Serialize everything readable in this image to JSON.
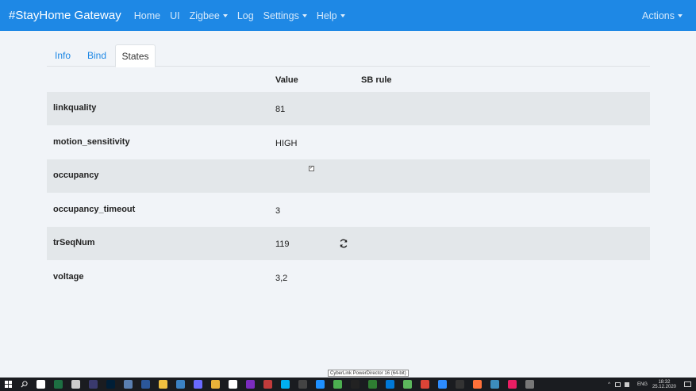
{
  "app": {
    "brand": "#StayHome Gateway",
    "nav": [
      {
        "label": "Home",
        "dropdown": false
      },
      {
        "label": "UI",
        "dropdown": false
      },
      {
        "label": "Zigbee",
        "dropdown": true
      },
      {
        "label": "Log",
        "dropdown": false
      },
      {
        "label": "Settings",
        "dropdown": true
      },
      {
        "label": "Help",
        "dropdown": true
      }
    ],
    "actions": "Actions"
  },
  "tabs": [
    {
      "label": "Info",
      "active": false
    },
    {
      "label": "Bind",
      "active": false
    },
    {
      "label": "States",
      "active": true
    }
  ],
  "table": {
    "columns": {
      "value": "Value",
      "rule": "SB rule"
    },
    "rows": [
      {
        "key": "linkquality",
        "value": "81"
      },
      {
        "key": "motion_sensitivity",
        "value": "HIGH"
      },
      {
        "key": "occupancy",
        "value": "",
        "checked": true
      },
      {
        "key": "occupancy_timeout",
        "value": "3"
      },
      {
        "key": "trSeqNum",
        "value": "119",
        "refresh": true
      },
      {
        "key": "voltage",
        "value": "3,2"
      }
    ]
  },
  "taskbar": {
    "tooltip": "CyberLink PowerDirector 16 (64-bit)",
    "language": "ENG",
    "time": "18:32",
    "date": "25.12.2020",
    "icon_colors": [
      "#ffffff",
      "#1d6f42",
      "#cccccc",
      "#3a3a6e",
      "#001e36",
      "#5a7fb0",
      "#2b579a",
      "#f0c040",
      "#3b82c4",
      "#6a6aff",
      "#e8b339",
      "#ffffff",
      "#7b2cbf",
      "#c23b3b",
      "#00aff0",
      "#444444",
      "#1e90ff",
      "#4caf50",
      "#222222",
      "#2f7d32",
      "#0078d7",
      "#5cb85c",
      "#db4437",
      "#2d8cff",
      "#333333",
      "#ff7139",
      "#3c8dbc",
      "#e91e63",
      "#777777"
    ]
  },
  "colors": {
    "navbar": "#1e88e5",
    "accent": "#1e88e5",
    "row_shade": "#e3e7ea",
    "background": "#f1f4f8"
  }
}
